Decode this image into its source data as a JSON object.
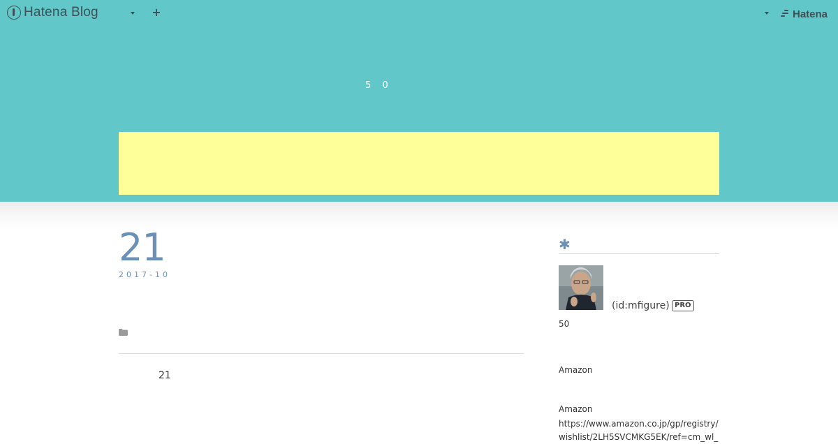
{
  "topbar": {
    "brand_name": "Hatena Blog",
    "brand_icon": "hatena-blog-logo-icon",
    "menu_caret_icon": "caret-down-icon",
    "add_icon": "plus-icon",
    "add_label": "+",
    "account_caret_icon": "caret-down-icon",
    "hatena_icon": "hatena-logo-icon",
    "hatena_label": "Hatena"
  },
  "header": {
    "blog_title": "5 0",
    "background_color": "#61c7c8",
    "banner_color": "#ffff99"
  },
  "entry": {
    "day": "21",
    "year_month": "2017-10",
    "category_icon": "folder-icon",
    "body_text": "21",
    "date_color": "#6b90b8"
  },
  "sidebar": {
    "heading_mark": "✱",
    "profile": {
      "avatar_icon": "avatar",
      "id_text": "(id:mfigure)",
      "badge": "PRO",
      "about": "50"
    },
    "amazon_heading": "Amazon",
    "amazon_label": "Amazon",
    "amazon_url": "https://www.amazon.co.jp/gp/registry/wishlist/2LH5SVCMKG5EK/ref=cm_wl_"
  }
}
